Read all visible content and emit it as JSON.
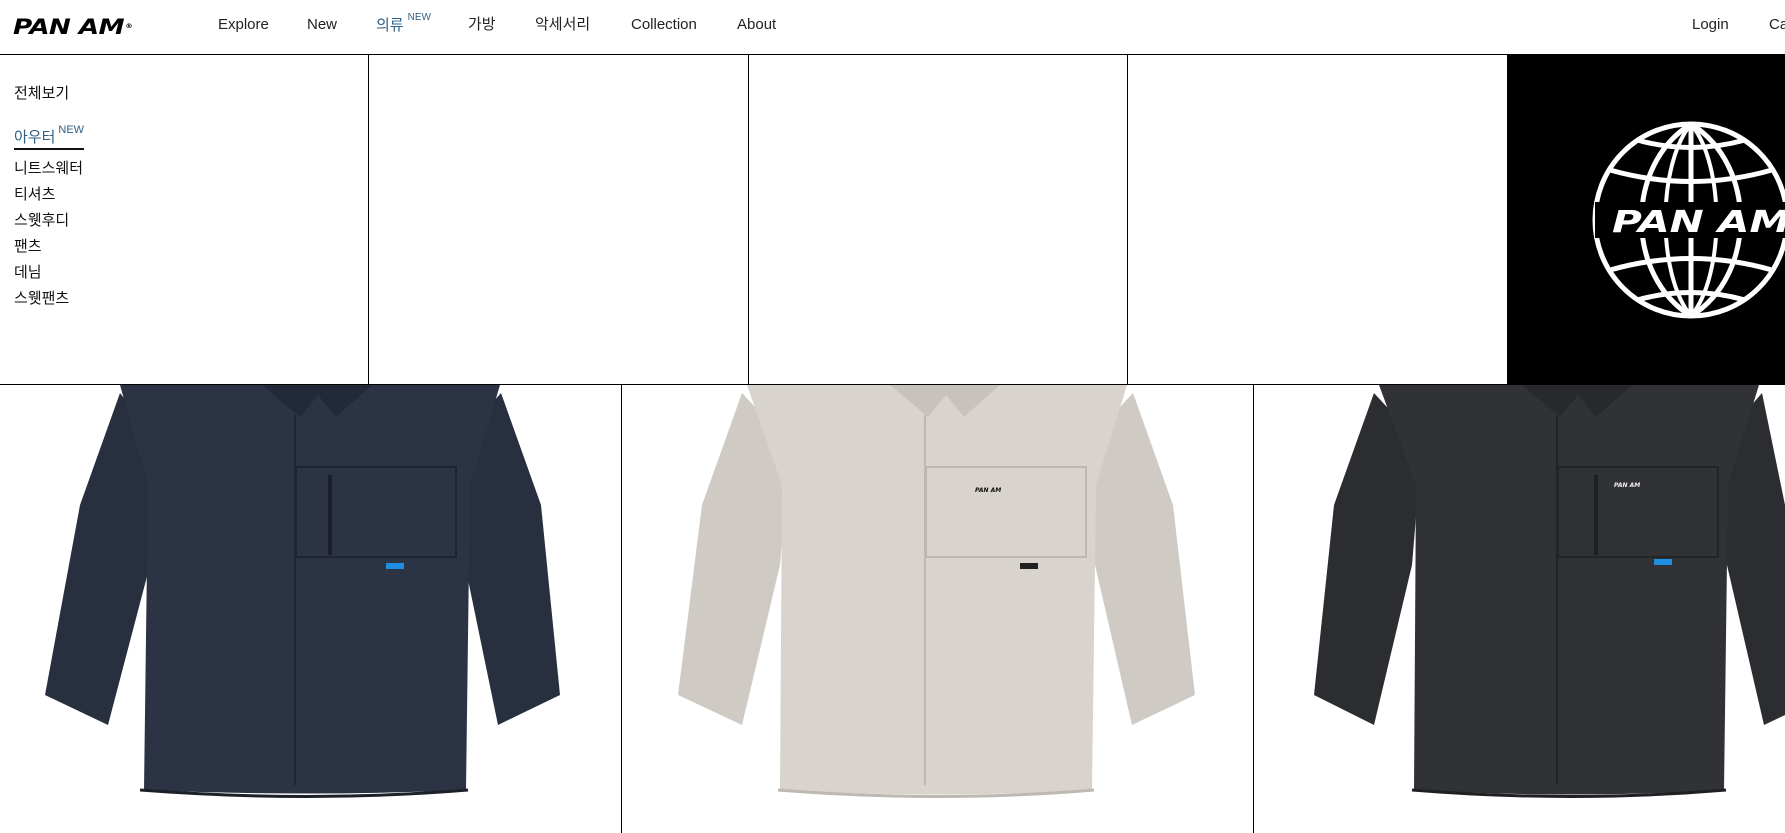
{
  "header": {
    "logo_text": "PAN AM",
    "logo_mark": "®",
    "nav": [
      {
        "label": "Explore"
      },
      {
        "label": "New"
      },
      {
        "label": "의류",
        "badge": "NEW"
      },
      {
        "label": "가방"
      },
      {
        "label": "악세서리"
      },
      {
        "label": "Collection"
      },
      {
        "label": "About"
      }
    ],
    "login_label": "Login",
    "cart_label": "Ca"
  },
  "menu": {
    "all_label": "전체보기",
    "categories": [
      {
        "label": "아우터",
        "badge": "NEW",
        "active": true
      },
      {
        "label": "니트스웨터"
      },
      {
        "label": "티셔츠"
      },
      {
        "label": "스웻후디"
      },
      {
        "label": "팬츠"
      },
      {
        "label": "데님"
      },
      {
        "label": "스웻팬츠"
      }
    ],
    "brand_logo_text": "PAN AM"
  },
  "products": [
    {
      "name": "navy-overshirt",
      "color": "#2b3140",
      "tag_color": "#1e8fe0",
      "chest_logo": ""
    },
    {
      "name": "beige-overshirt",
      "color": "#d7d3cc",
      "tag_color": "#222222",
      "chest_logo": "PAN AM"
    },
    {
      "name": "charcoal-overshirt",
      "color": "#2e3033",
      "tag_color": "#1e8fe0",
      "chest_logo": "PAN AM"
    }
  ],
  "colors": {
    "accent": "#2e5f85",
    "border": "#000000"
  }
}
